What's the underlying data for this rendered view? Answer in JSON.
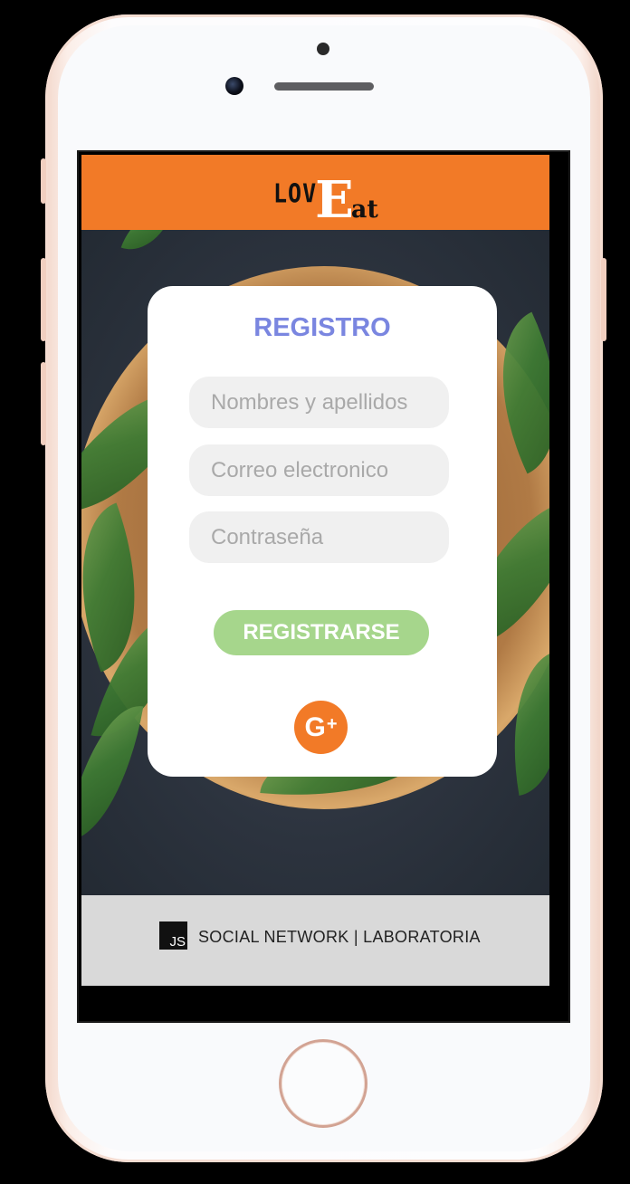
{
  "app": {
    "logo": {
      "part1": "LOV",
      "part2": "E",
      "part3": "at"
    },
    "accent_color": "#f27a27"
  },
  "register_card": {
    "title": "REGISTRO",
    "title_color": "#7a86e0",
    "fields": {
      "name_placeholder": "Nombres y apellidos",
      "email_placeholder": "Correo electronico",
      "password_placeholder": "Contraseña"
    },
    "submit_label": "REGISTRARSE",
    "submit_color": "#a6d68c",
    "google_button": {
      "icon": "google-plus-icon",
      "g": "G",
      "plus": "+"
    }
  },
  "footer": {
    "badge": "JS",
    "text": "SOCIAL NETWORK | LABORATORIA"
  }
}
